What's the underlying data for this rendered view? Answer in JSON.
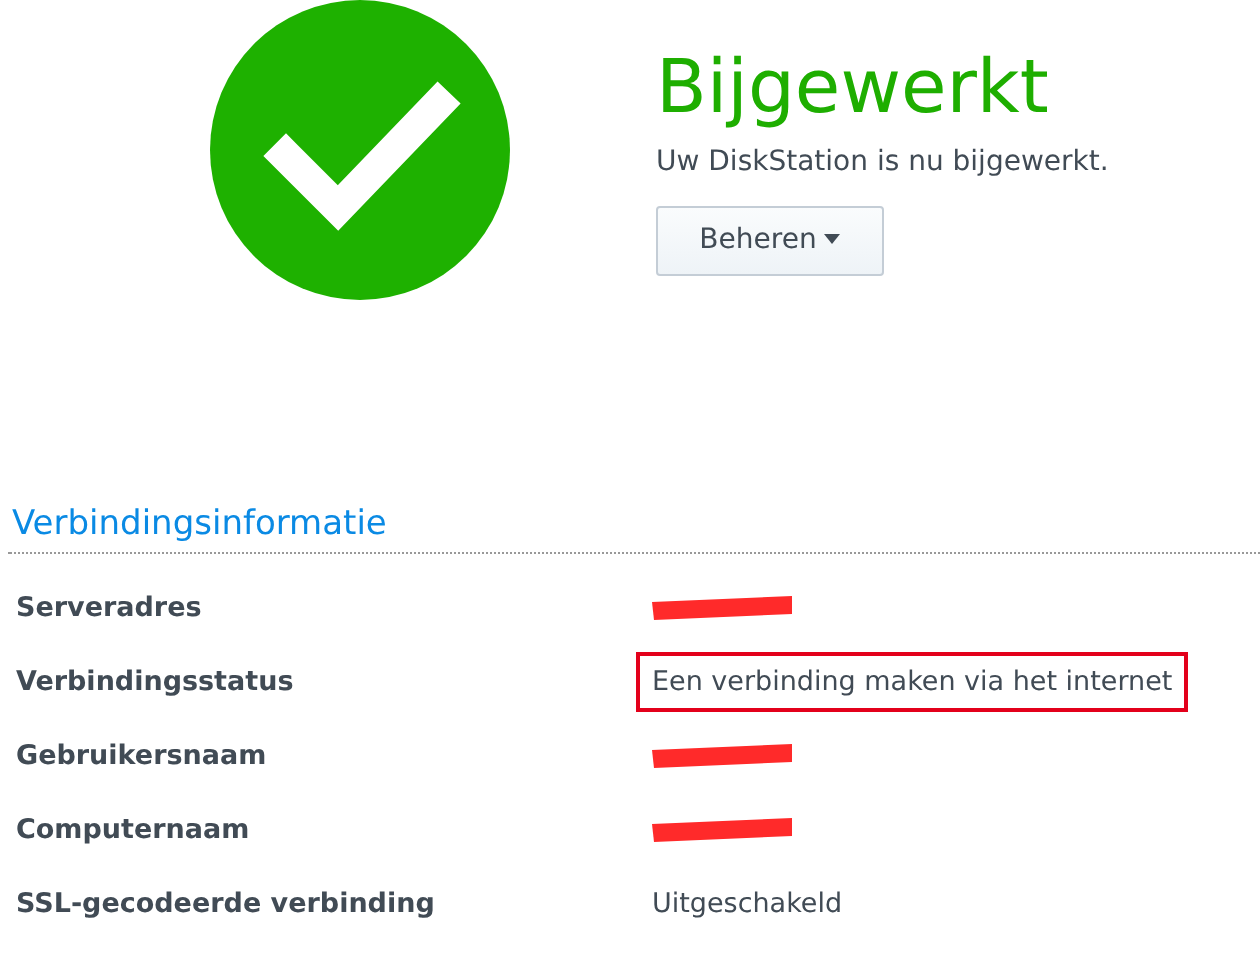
{
  "status": {
    "title": "Bijgewerkt",
    "message": "Uw DiskStation is nu bijgewerkt.",
    "menu_button": {
      "label": "Beheren"
    }
  },
  "section": {
    "title": "Verbindingsinformatie",
    "rows": [
      {
        "label": "Serveradres",
        "kind": "redacted"
      },
      {
        "label": "Verbindingsstatus",
        "value": "Een verbinding maken via het internet",
        "kind": "boxed"
      },
      {
        "label": "Gebruikersnaam",
        "kind": "redacted"
      },
      {
        "label": "Computernaam",
        "kind": "redacted"
      },
      {
        "label": "SSL-gecodeerde verbinding",
        "value": "Uitgeschakeld",
        "kind": "plain"
      }
    ]
  }
}
